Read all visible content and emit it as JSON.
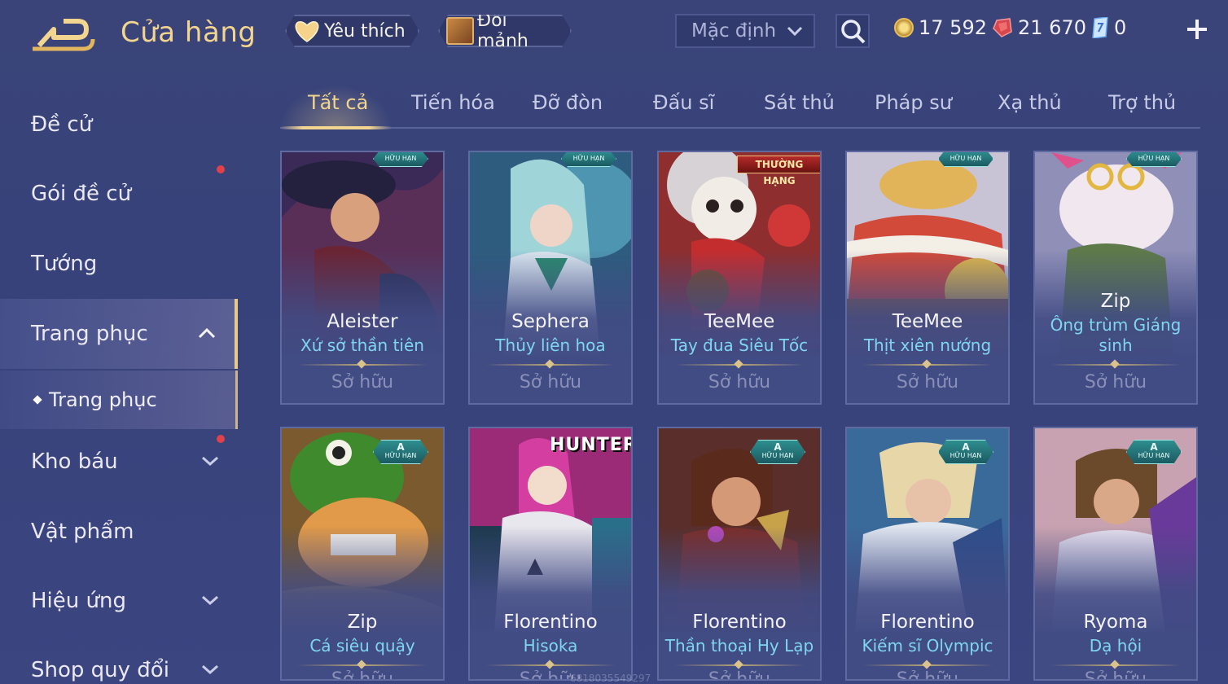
{
  "header": {
    "title": "Cửa hàng",
    "favorites_label": "Yêu thích",
    "shard_exchange_label": "Đổi mảnh",
    "sort": {
      "selected": "Mặc định"
    },
    "currencies": {
      "gold": "17 592",
      "gems": "21 670",
      "vouchers": "0"
    }
  },
  "sidebar": {
    "items": [
      {
        "label": "Đề cử"
      },
      {
        "label": "Gói đề cử"
      },
      {
        "label": "Tướng"
      },
      {
        "label": "Trang phục"
      },
      {
        "label": "Kho báu"
      },
      {
        "label": "Vật phẩm"
      },
      {
        "label": "Hiệu ứng"
      },
      {
        "label": "Shop quy đổi"
      }
    ],
    "sub_item": {
      "label": "Trang phục"
    }
  },
  "tabs": [
    "Tất cả",
    "Tiến hóa",
    "Đỡ đòn",
    "Đấu sĩ",
    "Sát thủ",
    "Pháp sư",
    "Xạ thủ",
    "Trợ thủ"
  ],
  "badges": {
    "limited": "HỮU HẠN",
    "rank_a": "A",
    "ranked": "THƯỜNG HẠNG",
    "hunter": "HUNTER"
  },
  "cards": [
    {
      "hero": "Aleister",
      "skin": "Xứ sở thần tiên",
      "status": "Sở hữu"
    },
    {
      "hero": "Sephera",
      "skin": "Thủy liên hoa",
      "status": "Sở hữu"
    },
    {
      "hero": "TeeMee",
      "skin": "Tay đua Siêu Tốc",
      "status": "Sở hữu"
    },
    {
      "hero": "TeeMee",
      "skin": "Thịt xiên nướng",
      "status": "Sở hữu"
    },
    {
      "hero": "Zip",
      "skin": "Ông trùm Giáng sinh",
      "status": "Sở hữu"
    },
    {
      "hero": "Zip",
      "skin": "Cá siêu quậy",
      "status": "Sở hữu"
    },
    {
      "hero": "Florentino",
      "skin": "Hisoka",
      "status": "Sở hữu"
    },
    {
      "hero": "Florentino",
      "skin": "Thần thoại Hy Lạp",
      "status": "Sở hữu"
    },
    {
      "hero": "Florentino",
      "skin": "Kiếm sĩ Olympic",
      "status": "Sở hữu"
    },
    {
      "hero": "Ryoma",
      "skin": "Dạ hội",
      "status": "Sở hữu"
    }
  ],
  "watermark": "6818035549297",
  "colors": {
    "accent_gold": "#f2d58f",
    "skin_name": "#7fd6ef",
    "notify_dot": "#e0414a"
  },
  "icons": [
    "back-icon",
    "heart-icon",
    "shard-box-icon",
    "chevron-down-icon",
    "search-icon",
    "gold-coin-icon",
    "red-gem-icon",
    "voucher-icon",
    "plus-icon",
    "chevron-up-icon"
  ]
}
